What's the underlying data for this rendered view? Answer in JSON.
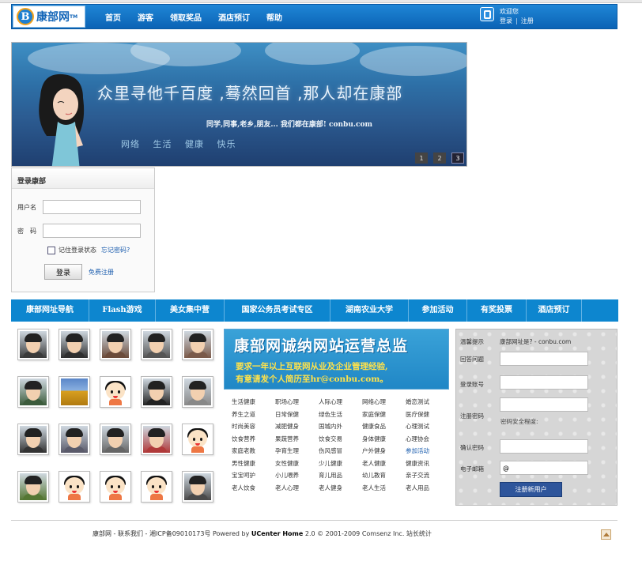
{
  "header": {
    "logo_mark": "B",
    "logo_text": "康部网",
    "logo_tm": "TM",
    "nav": [
      "首页",
      "游客",
      "领取奖品",
      "酒店预订",
      "帮助"
    ],
    "user": {
      "welcome": "欢迎您",
      "login": "登录",
      "register": "注册"
    }
  },
  "banner": {
    "headline": "众里寻他千百度 ,蓦然回首 ,那人却在康部",
    "subline": "同学,同事,老乡,朋友... 我们都在康部! conbu.com",
    "tags": [
      "网络",
      "生活",
      "健康",
      "快乐"
    ],
    "pages": [
      "1",
      "2",
      "3"
    ],
    "active_page": 2
  },
  "login": {
    "title": "登录康部",
    "username_label": "用户名",
    "password_label": "密　码",
    "remember": "记住登录状态",
    "forgot": "忘记密码?",
    "submit": "登录",
    "register": "免费注册"
  },
  "catbar": [
    "康部网址导航",
    "Flash游戏",
    "美女集中营",
    "国家公务员考试专区",
    "湖南农业大学",
    "参加活动",
    "有奖投票",
    "酒店预订"
  ],
  "ad": {
    "title": "康部网诚纳网站运营总监",
    "line1": "要求一年以上互联网从业及企业管理经验,",
    "line2": "有意请发个人简历至hr@conbu.com。"
  },
  "tags": [
    [
      "生活健康",
      "职场心理",
      "人际心理",
      "网络心理",
      "婚恋测试"
    ],
    [
      "养生之道",
      "日常保健",
      "绿色生活",
      "家庭保健",
      "医疗保健"
    ],
    [
      "时尚美容",
      "减肥健身",
      "国城内外",
      "健康食品",
      "心理测试"
    ],
    [
      "饮食营养",
      "果蔬营养",
      "饮食交易",
      "身体健康",
      "心理协会"
    ],
    [
      "家庭老教",
      "孕育生理",
      "伤风感冒",
      "户外健身",
      "参加活动"
    ],
    [
      "男性健康",
      "女性健康",
      "少儿健康",
      "老人健康",
      "健康资讯"
    ],
    [
      "宝宝呵护",
      "小儿喂养",
      "育儿用品",
      "幼儿教育",
      "亲子交流"
    ],
    [
      "老人饮食",
      "老人心理",
      "老人健身",
      "老人生活",
      "老人用品"
    ]
  ],
  "register": {
    "tip_label": "温馨提示",
    "tip_value": "康部网址是? - conbu.com",
    "answer_label": "回答问题",
    "account_label": "登录账号",
    "password_label": "注册密码",
    "strength_label": "密码安全程度:",
    "confirm_label": "确认密码",
    "email_label": "电子邮箱",
    "email_value": "@",
    "submit": "注册新用户"
  },
  "footer": {
    "prefix": "康部网 - 联系我们 - 湘ICP备09010173号  Powered by ",
    "brand": "UCenter Home",
    "suffix": " 2.0 © 2001-2009 Comsenz Inc. 站长统计"
  }
}
